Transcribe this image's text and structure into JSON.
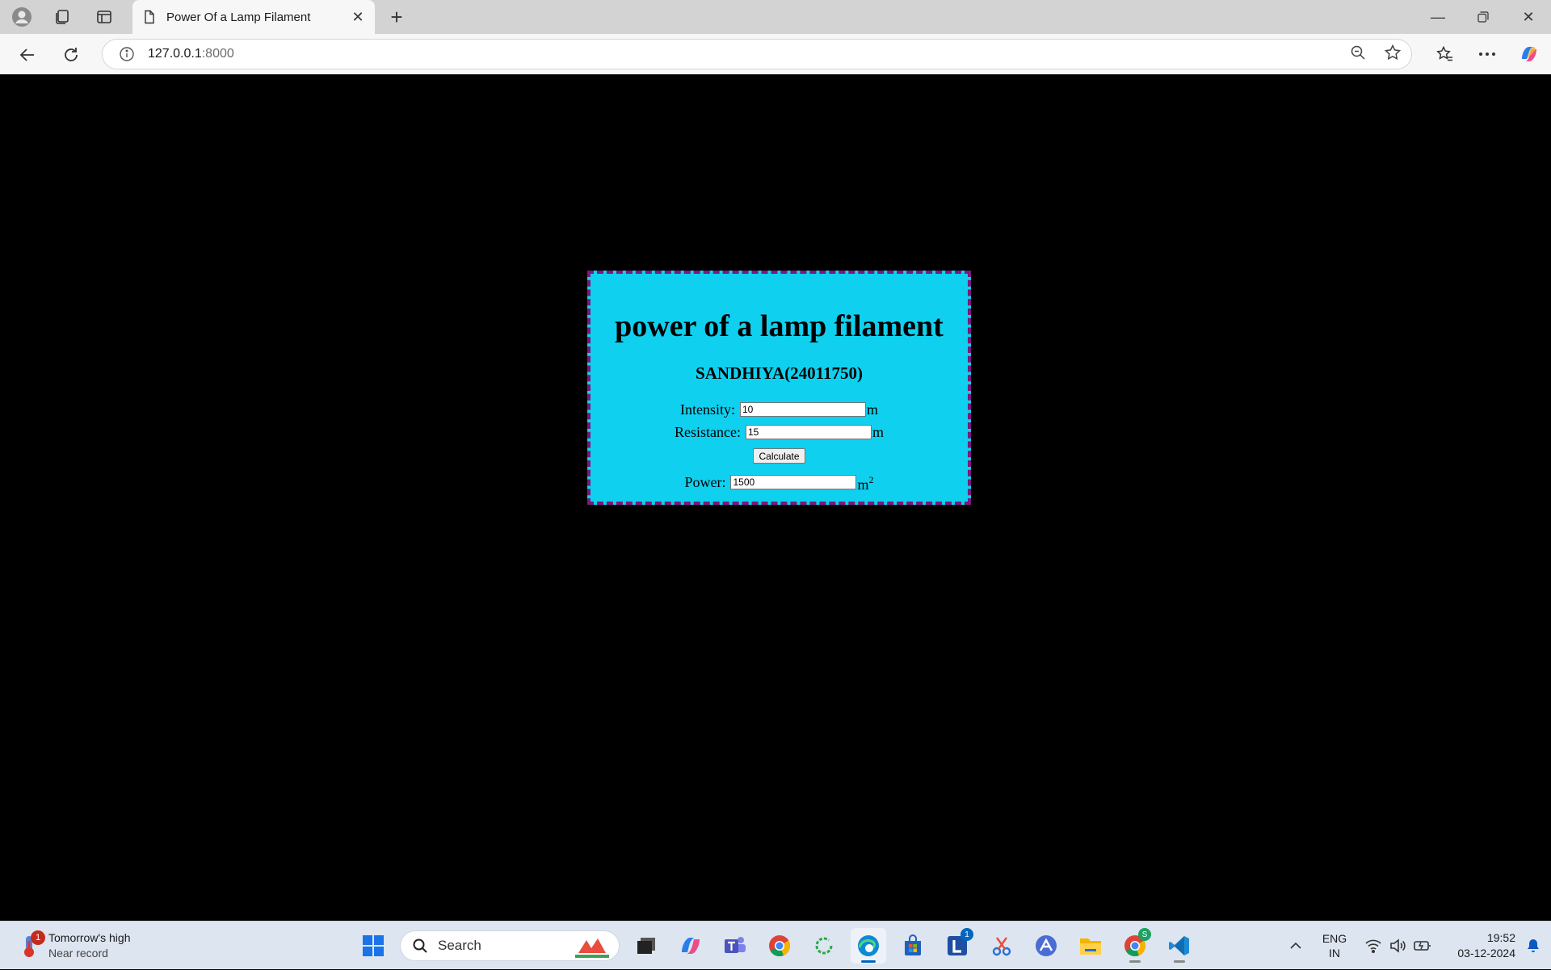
{
  "browser": {
    "tab_title": "Power Of a Lamp Filament",
    "url_host": "127.0.0.1",
    "url_port": ":8000"
  },
  "page": {
    "heading": "power of a lamp filament",
    "subheading": "SANDHIYA(24011750)",
    "fields": {
      "intensity": {
        "label": "Intensity:",
        "value": "10",
        "unit": "m"
      },
      "resistance": {
        "label": "Resistance:",
        "value": "15",
        "unit": "m"
      },
      "power": {
        "label": "Power:",
        "value": "1500",
        "unit": "m",
        "unit_sup": "2"
      }
    },
    "calculate_label": "Calculate",
    "colors": {
      "card_background": "#0fd0ef",
      "card_border": "#7a1a7a",
      "page_background": "#000000"
    }
  },
  "taskbar": {
    "weather_title": "Tomorrow's high",
    "weather_subtitle": "Near record",
    "weather_badge": "1",
    "search_placeholder": "Search",
    "lstore_badge": "1",
    "chrome_badge": "S",
    "lang_top": "ENG",
    "lang_bottom": "IN",
    "time": "19:52",
    "date": "03-12-2024"
  }
}
